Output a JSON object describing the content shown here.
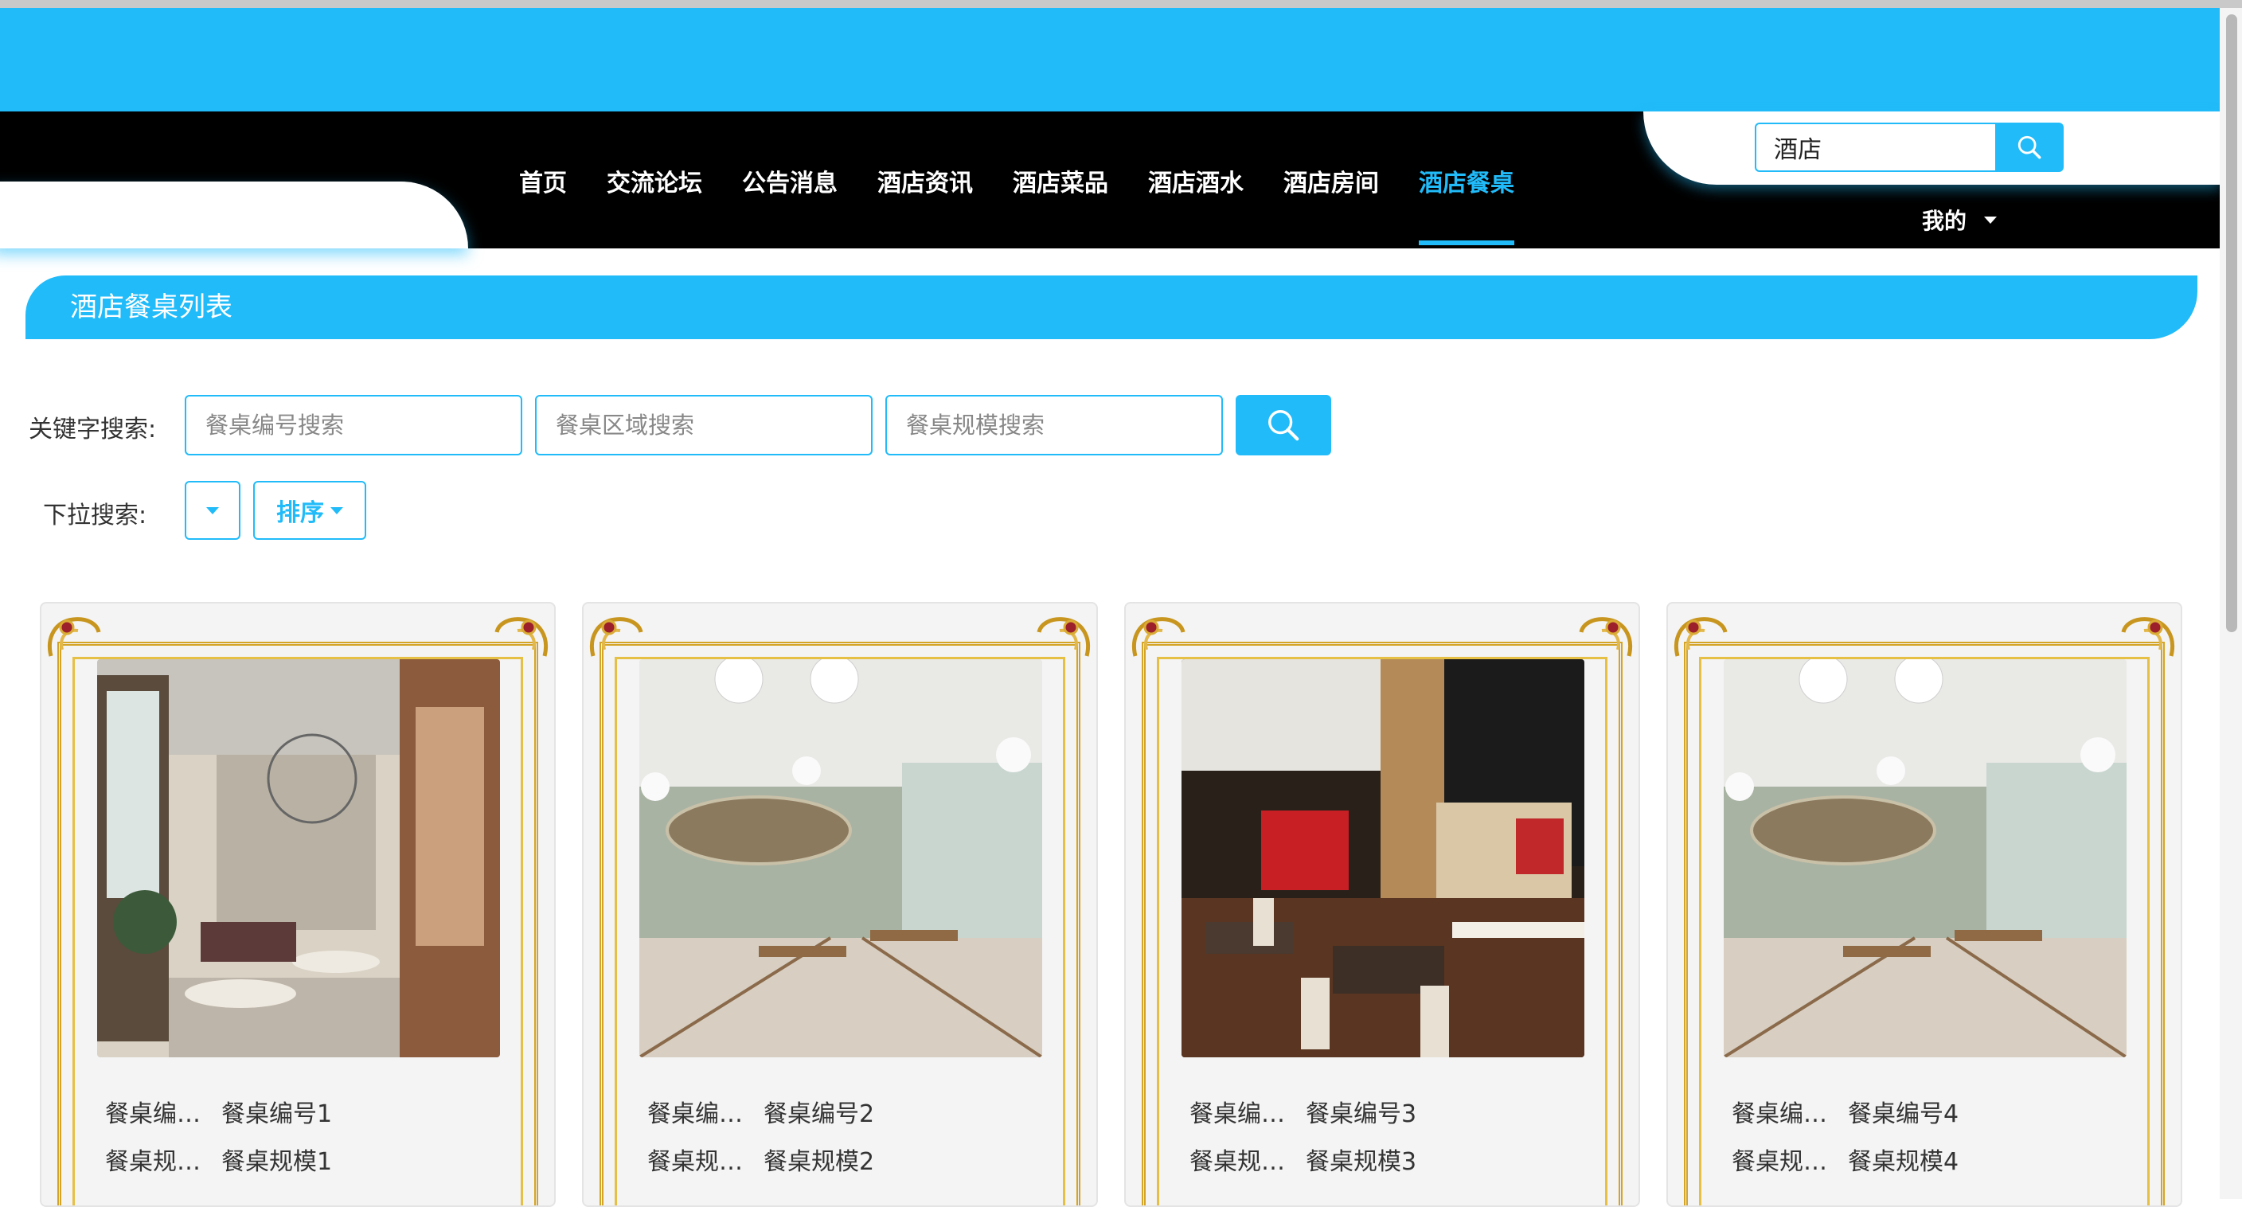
{
  "nav": {
    "items": [
      "首页",
      "交流论坛",
      "公告消息",
      "酒店资讯",
      "酒店菜品",
      "酒店酒水",
      "酒店房间",
      "酒店餐桌"
    ],
    "active_index": 7,
    "search_value": "酒店",
    "my_label": "我的",
    "accent_color": "#21bbf9"
  },
  "section": {
    "title": "酒店餐桌列表"
  },
  "filters": {
    "keyword_label": "关键字搜索:",
    "fields": [
      {
        "placeholder": "餐桌编号搜索"
      },
      {
        "placeholder": "餐桌区域搜索"
      },
      {
        "placeholder": "餐桌规模搜索"
      }
    ],
    "dropdown_label": "下拉搜索:",
    "sort_label": "排序"
  },
  "cards": [
    {
      "row1_label": "餐桌编…",
      "row1_value": "餐桌编号1",
      "row2_label": "餐桌规…",
      "row2_value": "餐桌规模1"
    },
    {
      "row1_label": "餐桌编…",
      "row1_value": "餐桌编号2",
      "row2_label": "餐桌规…",
      "row2_value": "餐桌规模2"
    },
    {
      "row1_label": "餐桌编…",
      "row1_value": "餐桌编号3",
      "row2_label": "餐桌规…",
      "row2_value": "餐桌规模3"
    },
    {
      "row1_label": "餐桌编…",
      "row1_value": "餐桌编号4",
      "row2_label": "餐桌规…",
      "row2_value": "餐桌规模4"
    }
  ]
}
